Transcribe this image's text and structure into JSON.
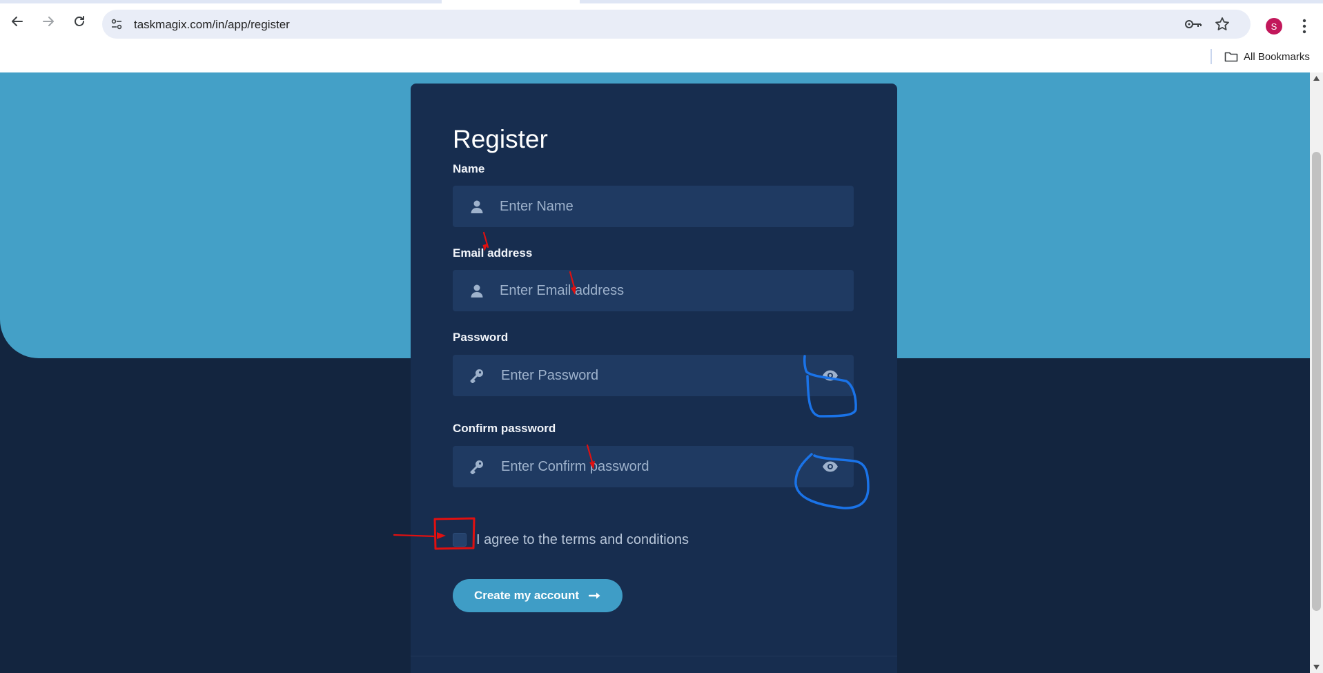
{
  "browser": {
    "url": "taskmagix.com/in/app/register",
    "profile_initial": "S",
    "bookmarks_label": "All Bookmarks"
  },
  "form": {
    "title": "Register",
    "name": {
      "label": "Name",
      "placeholder": "Enter Name",
      "icon": "user-icon"
    },
    "email": {
      "label": "Email address",
      "placeholder": "Enter Email address",
      "icon": "user-icon"
    },
    "password": {
      "label": "Password",
      "placeholder": "Enter Password",
      "icon": "key-icon",
      "toggle_icon": "eye-icon"
    },
    "confirm_password": {
      "label": "Confirm password",
      "placeholder": "Enter Confirm password",
      "icon": "key-icon",
      "toggle_icon": "eye-icon"
    },
    "terms_label": "I agree to the terms and conditions",
    "terms_checked": false,
    "submit_label": "Create my account",
    "submit_icon": "arrow-right-icon"
  },
  "colors": {
    "page_background": "#13253f",
    "hero_background": "#44a0c7",
    "card_background": "#172d4f",
    "input_background": "#1f3a62",
    "button_background": "#3f9dc6",
    "annotation_red": "#e01010",
    "annotation_blue": "#1a73e8"
  }
}
